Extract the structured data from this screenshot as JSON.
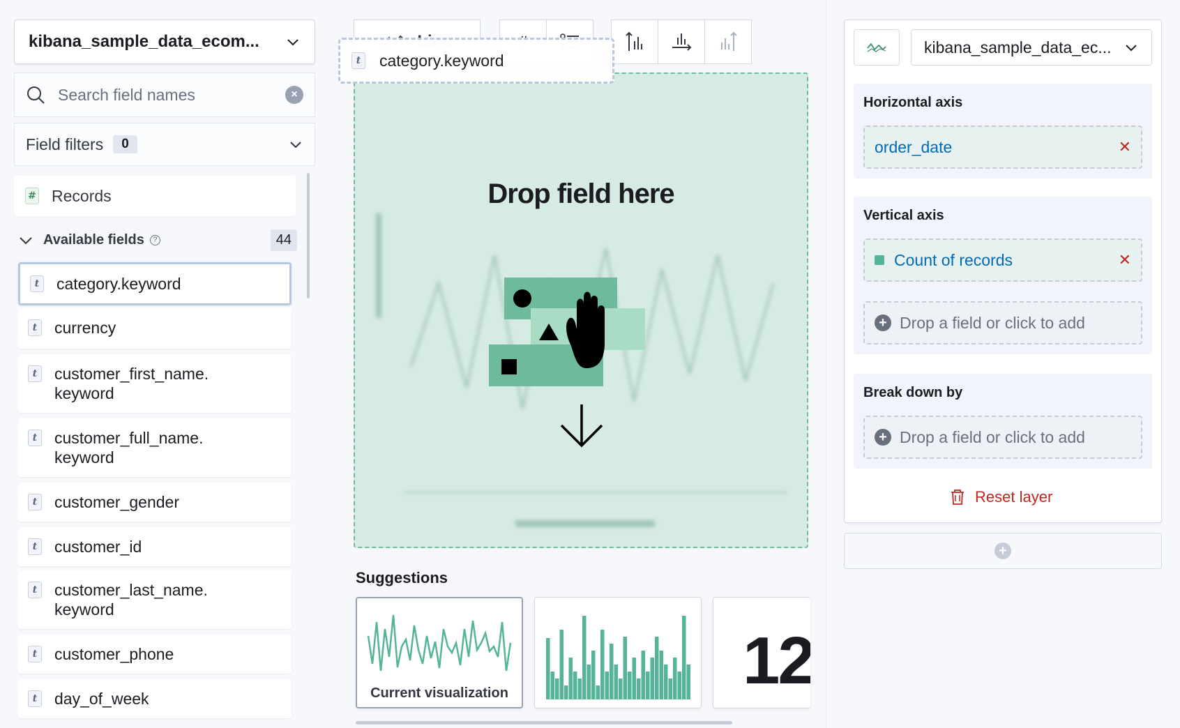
{
  "left": {
    "index_pattern": "kibana_sample_data_ecom...",
    "search_placeholder": "Search field names",
    "field_filters_label": "Field filters",
    "field_filters_count": "0",
    "records_label": "Records",
    "records_icon": "#",
    "available_label": "Available fields",
    "available_count": "44",
    "fields": [
      {
        "icon": "t",
        "name": "category.keyword"
      },
      {
        "icon": "t",
        "name": "currency"
      },
      {
        "icon": "t",
        "name": "customer_first_name.\nkeyword"
      },
      {
        "icon": "t",
        "name": "customer_full_name.\nkeyword"
      },
      {
        "icon": "t",
        "name": "customer_gender"
      },
      {
        "icon": "t",
        "name": "customer_id"
      },
      {
        "icon": "t",
        "name": "customer_last_name.\nkeyword"
      },
      {
        "icon": "t",
        "name": "customer_phone"
      },
      {
        "icon": "t",
        "name": "day_of_week"
      }
    ]
  },
  "toolbar": {
    "chart_type_label": "Line",
    "hash_icon": "#"
  },
  "drag": {
    "icon": "t",
    "field_name": "category.keyword"
  },
  "dropzone": {
    "title": "Drop field here"
  },
  "suggestions": {
    "title": "Suggestions",
    "items": [
      {
        "caption": "Current visualization"
      },
      {
        "caption": ""
      },
      {
        "caption": "",
        "value": "12"
      }
    ]
  },
  "right": {
    "index_pattern": "kibana_sample_data_ec...",
    "horizontal_axis": {
      "title": "Horizontal axis",
      "field": "order_date"
    },
    "vertical_axis": {
      "title": "Vertical axis",
      "field": "Count of records",
      "add_placeholder": "Drop a field or click to add"
    },
    "breakdown": {
      "title": "Break down by",
      "add_placeholder": "Drop a field or click to add"
    },
    "reset_label": "Reset layer"
  },
  "colors": {
    "accent_green": "#54b399",
    "link_blue": "#006bb8",
    "danger_red": "#bd271e"
  }
}
